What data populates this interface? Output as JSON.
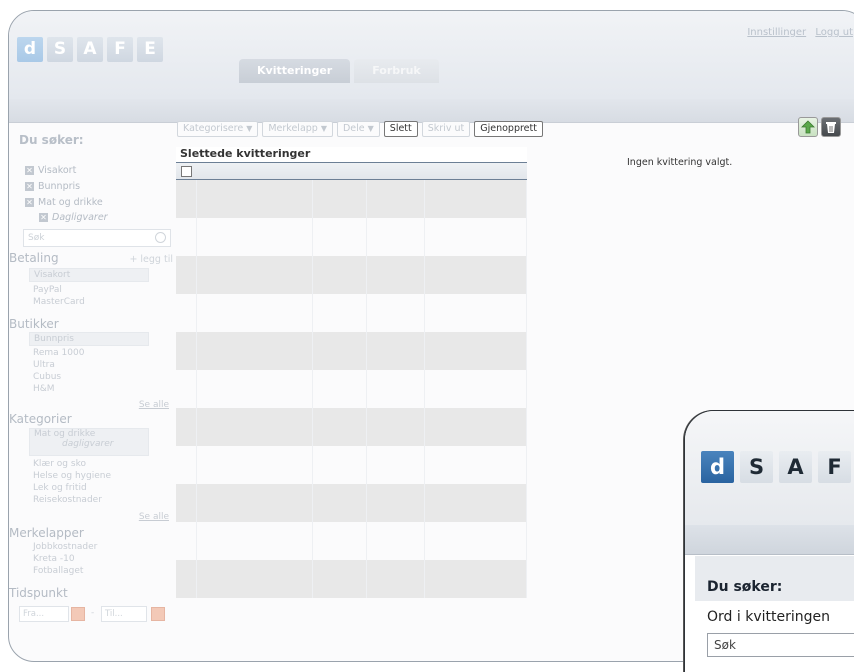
{
  "app": {
    "logo_letters": [
      "d",
      "S",
      "A",
      "F",
      "E"
    ],
    "tabs": [
      {
        "label": "Kvitteringer",
        "active": true
      },
      {
        "label": "Forbruk",
        "active": false
      }
    ],
    "top_links": {
      "settings": "Innstillinger",
      "logout": "Logg ut"
    }
  },
  "sidebar": {
    "title": "Du søker:",
    "filters": [
      "Visakort",
      "Bunnpris",
      "Mat og drikke"
    ],
    "sub_filter": "Dagligvarer",
    "search_placeholder": "Søk",
    "payment": {
      "title": "Betaling",
      "add_label": "+ legg til",
      "items": [
        "Visakort",
        "PayPal",
        "MasterCard"
      ]
    },
    "stores": {
      "title": "Butikker",
      "items": [
        "Bunnpris",
        "Rema 1000",
        "Ultra",
        "Cubus",
        "H&M"
      ],
      "see_all": "Se alle"
    },
    "categories": {
      "title": "Kategorier",
      "selected": "Mat og drikke",
      "selected_sub": "dagligvarer",
      "items": [
        "Klær og sko",
        "Helse og hygiene",
        "Lek og fritid",
        "Reisekostnader"
      ],
      "see_all": "Se alle"
    },
    "tags": {
      "title": "Merkelapper",
      "items": [
        "Jobbkostnader",
        "Kreta -10",
        "Fotballaget"
      ]
    },
    "time": {
      "title": "Tidspunkt",
      "from_placeholder": "Fra...",
      "separator": "-",
      "to_placeholder": "Til..."
    }
  },
  "toolbar": {
    "categorize": "Kategorisere",
    "tag": "Merkelapp",
    "share": "Dele",
    "delete": "Slett",
    "print": "Skriv ut",
    "restore": "Gjenopprett"
  },
  "list": {
    "title": "Slettede kvitteringer",
    "row_pattern": [
      "gray",
      "white",
      "gray",
      "white",
      "gray",
      "white",
      "gray",
      "white",
      "gray",
      "white",
      "gray"
    ]
  },
  "detail": {
    "empty_message": "Ingen kvittering valgt."
  },
  "popup": {
    "logo_letters": [
      "d",
      "S",
      "A",
      "F"
    ],
    "title": "Du søker:",
    "label": "Ord i kvitteringen",
    "search_placeholder": "Søk"
  },
  "colors": {
    "popup_logo_accent": "#2a63a0",
    "list_border": "#6c7f95",
    "row_gray": "#e8e8e8"
  }
}
